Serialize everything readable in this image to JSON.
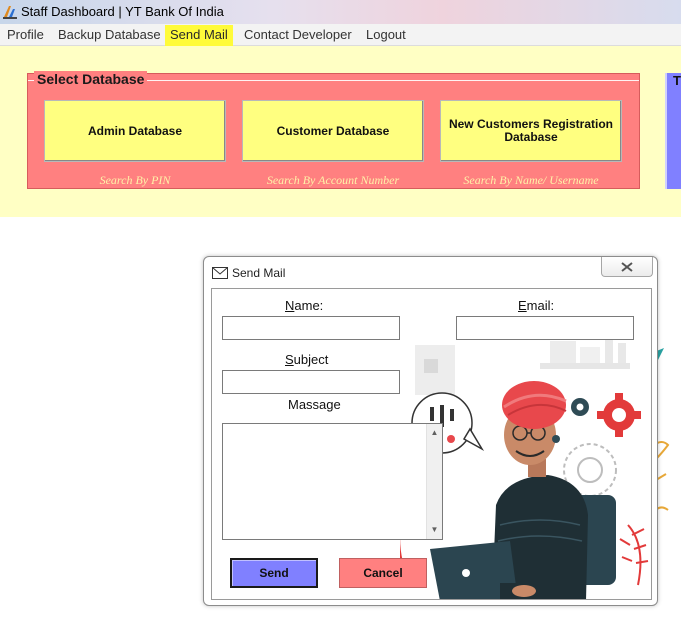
{
  "window": {
    "title": "Staff Dashboard | YT Bank Of India"
  },
  "menu": {
    "items": [
      {
        "label": "Profile"
      },
      {
        "label": "Backup Database"
      },
      {
        "label": "Send Mail"
      },
      {
        "label": "Contact Developer"
      },
      {
        "label": "Logout"
      }
    ]
  },
  "select_database": {
    "legend": "Select Database",
    "buttons": [
      {
        "label": "Admin Database",
        "caption": "Search By PIN"
      },
      {
        "label": "Customer Database",
        "caption": "Search By Account Number"
      },
      {
        "label": "New Customers Registration Database",
        "caption": "Search By Name/ Username"
      }
    ],
    "side_panel_text": "T"
  },
  "mail_dialog": {
    "title": "Send Mail",
    "name_label": "Name:",
    "email_label": "Email:",
    "subject_label": "Subject",
    "message_label": "Massage",
    "name_value": "",
    "email_value": "",
    "subject_value": "",
    "message_value": "",
    "send_label": "Send",
    "cancel_label": "Cancel"
  },
  "colors": {
    "menu_highlight": "#fffb3a",
    "top_panel": "#ffffc4",
    "select_db_bg": "#ff8080",
    "db_button": "#ffff80",
    "send_button": "#8080ff",
    "cancel_button": "#ff8080"
  },
  "icons": {
    "app": "app-icon",
    "mail": "envelope-icon",
    "close": "close-icon"
  }
}
